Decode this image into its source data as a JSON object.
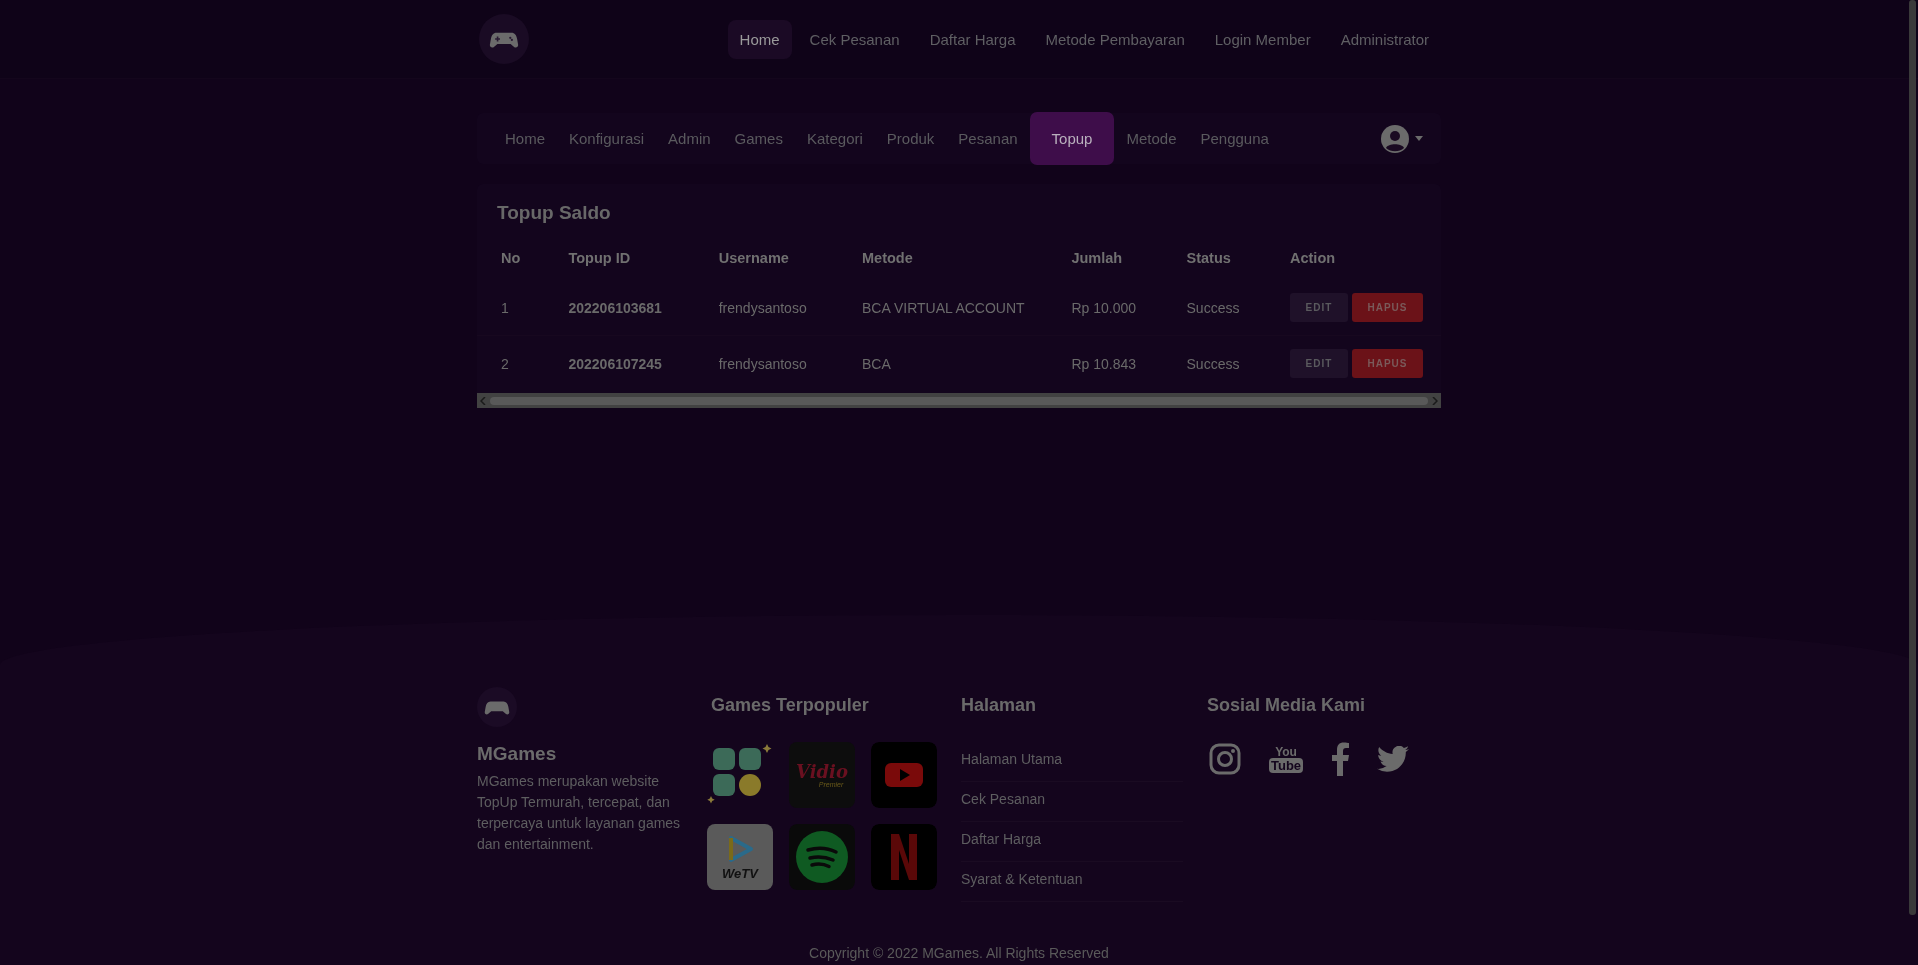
{
  "top_nav": [
    {
      "label": "Home",
      "selected": true
    },
    {
      "label": "Cek Pesanan",
      "selected": false
    },
    {
      "label": "Daftar Harga",
      "selected": false
    },
    {
      "label": "Metode Pembayaran",
      "selected": false
    },
    {
      "label": "Login Member",
      "selected": false
    },
    {
      "label": "Administrator",
      "selected": false
    }
  ],
  "admin_nav": [
    {
      "label": "Home",
      "selected": false
    },
    {
      "label": "Konfigurasi",
      "selected": false
    },
    {
      "label": "Admin",
      "selected": false
    },
    {
      "label": "Games",
      "selected": false
    },
    {
      "label": "Kategori",
      "selected": false
    },
    {
      "label": "Produk",
      "selected": false
    },
    {
      "label": "Pesanan",
      "selected": false
    },
    {
      "label": "Topup",
      "selected": true
    },
    {
      "label": "Metode",
      "selected": false
    },
    {
      "label": "Pengguna",
      "selected": false
    }
  ],
  "card": {
    "title": "Topup Saldo",
    "columns": [
      "No",
      "Topup ID",
      "Username",
      "Metode",
      "Jumlah",
      "Status",
      "Action"
    ],
    "rows": [
      {
        "no": "1",
        "topup_id": "202206103681",
        "username": "frendysantoso",
        "metode": "BCA VIRTUAL ACCOUNT",
        "jumlah": "Rp 10.000",
        "status": "Success",
        "actions": [
          {
            "label": "EDIT",
            "kind": "edit"
          },
          {
            "label": "HAPUS",
            "kind": "delete"
          }
        ]
      },
      {
        "no": "2",
        "topup_id": "202206107245",
        "username": "frendysantoso",
        "metode": "BCA",
        "jumlah": "Rp 10.843",
        "status": "Success",
        "actions": [
          {
            "label": "EDIT",
            "kind": "edit"
          },
          {
            "label": "HAPUS",
            "kind": "delete"
          }
        ]
      }
    ]
  },
  "footer": {
    "brand": "MGames",
    "description": "MGames merupakan website TopUp Termurah, tercepat, dan terpercaya untuk layanan games dan entertainment.",
    "games_heading": "Games Terpopuler",
    "games": [
      {
        "kind": "coins"
      },
      {
        "kind": "vidio",
        "label": "Vidio",
        "sublabel": "Premier"
      },
      {
        "kind": "youtube"
      },
      {
        "kind": "wetv",
        "label": "WeTV"
      },
      {
        "kind": "spotify"
      },
      {
        "kind": "netflix"
      }
    ],
    "pages_heading": "Halaman",
    "pages": [
      "Halaman Utama",
      "Cek Pesanan",
      "Daftar Harga",
      "Syarat & Ketentuan"
    ],
    "social_heading": "Sosial Media Kami",
    "social": [
      {
        "kind": "instagram"
      },
      {
        "kind": "youtube",
        "label": "You",
        "sublabel": "Tube"
      },
      {
        "kind": "facebook"
      },
      {
        "kind": "twitter"
      }
    ],
    "copyright": "Copyright © 2022 MGames. All Rights Reserved"
  }
}
